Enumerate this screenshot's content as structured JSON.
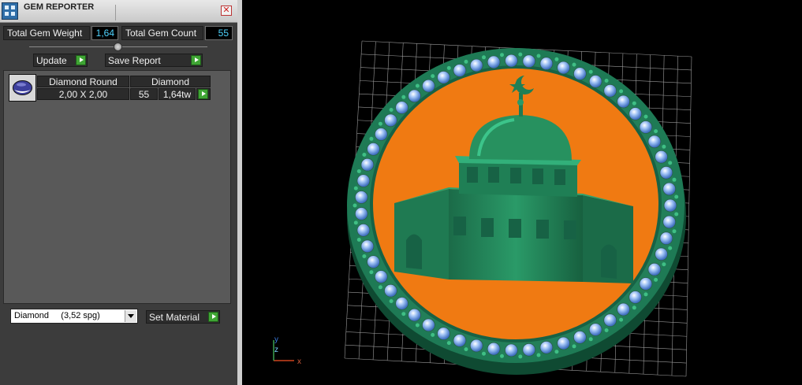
{
  "panel": {
    "title": "GEM REPORTER",
    "close_symbol": "✕",
    "total_weight_label": "Total Gem Weight",
    "total_weight_value": "1,64",
    "total_count_label": "Total Gem Count",
    "total_count_value": "55",
    "update_label": "Update",
    "save_report_label": "Save Report",
    "rows": [
      {
        "shape": "Diamond Round",
        "material": "Diamond",
        "size": "2,00 X 2,00",
        "count": "55",
        "weight": "1,64tw"
      }
    ],
    "material_select_value": "Diamond     (3,52 spg)",
    "set_material_label": "Set Material"
  },
  "viewport": {
    "axis_y": "y",
    "axis_z": "z",
    "axis_x": "x",
    "colors": {
      "background": "#000000",
      "grid": "#bfbfbf",
      "medallion": "#1e7a55",
      "face": "#f07a12",
      "gem": "#8fb6f0"
    }
  }
}
